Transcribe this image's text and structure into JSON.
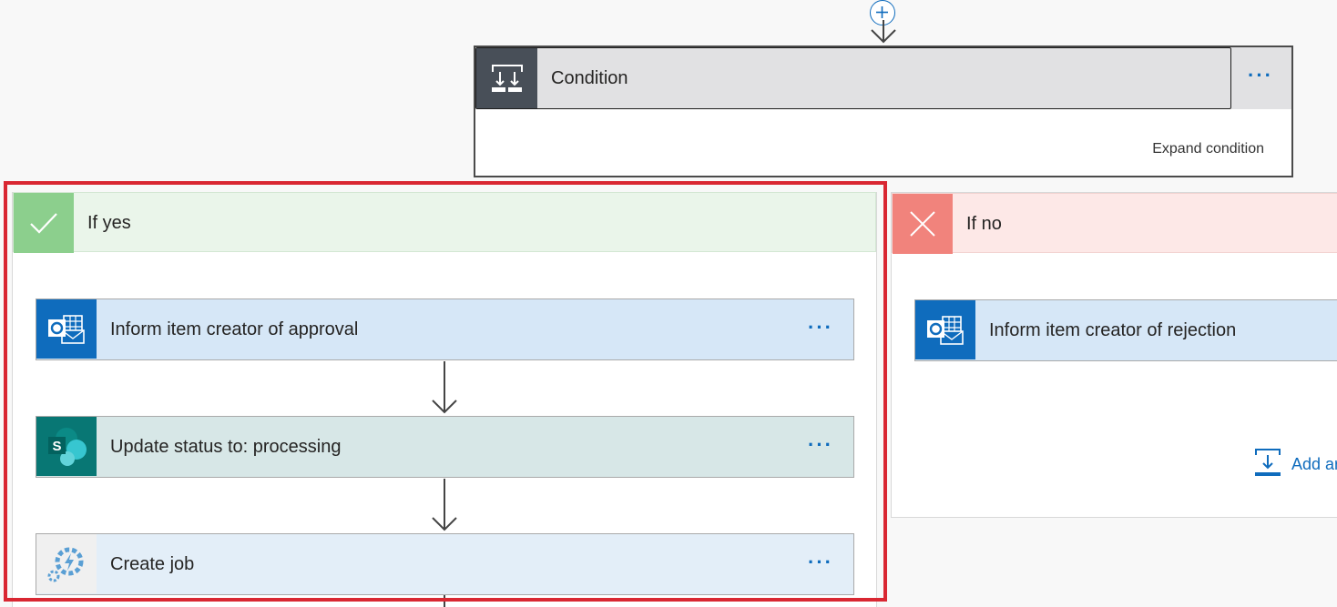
{
  "condition": {
    "title": "Condition",
    "menu_label": "···",
    "expand_label": "Expand condition"
  },
  "branch_yes": {
    "label": "If yes",
    "actions": [
      {
        "label": "Inform item creator of approval",
        "menu_label": "···",
        "icon": "outlook-icon"
      },
      {
        "label": "Update status to: processing",
        "menu_label": "···",
        "icon": "sharepoint-icon"
      },
      {
        "label": "Create job",
        "menu_label": "···",
        "icon": "automation-gear-icon"
      }
    ]
  },
  "branch_no": {
    "label": "If no",
    "actions": [
      {
        "label": "Inform item creator of rejection",
        "icon": "outlook-icon"
      }
    ],
    "add_action_label": "Add ar"
  },
  "colors": {
    "accent": "#0f6cbd",
    "yes_green": "#8ccf8d",
    "no_red": "#f1837c",
    "highlight_red": "#d92732",
    "sharepoint_teal": "#087774"
  }
}
